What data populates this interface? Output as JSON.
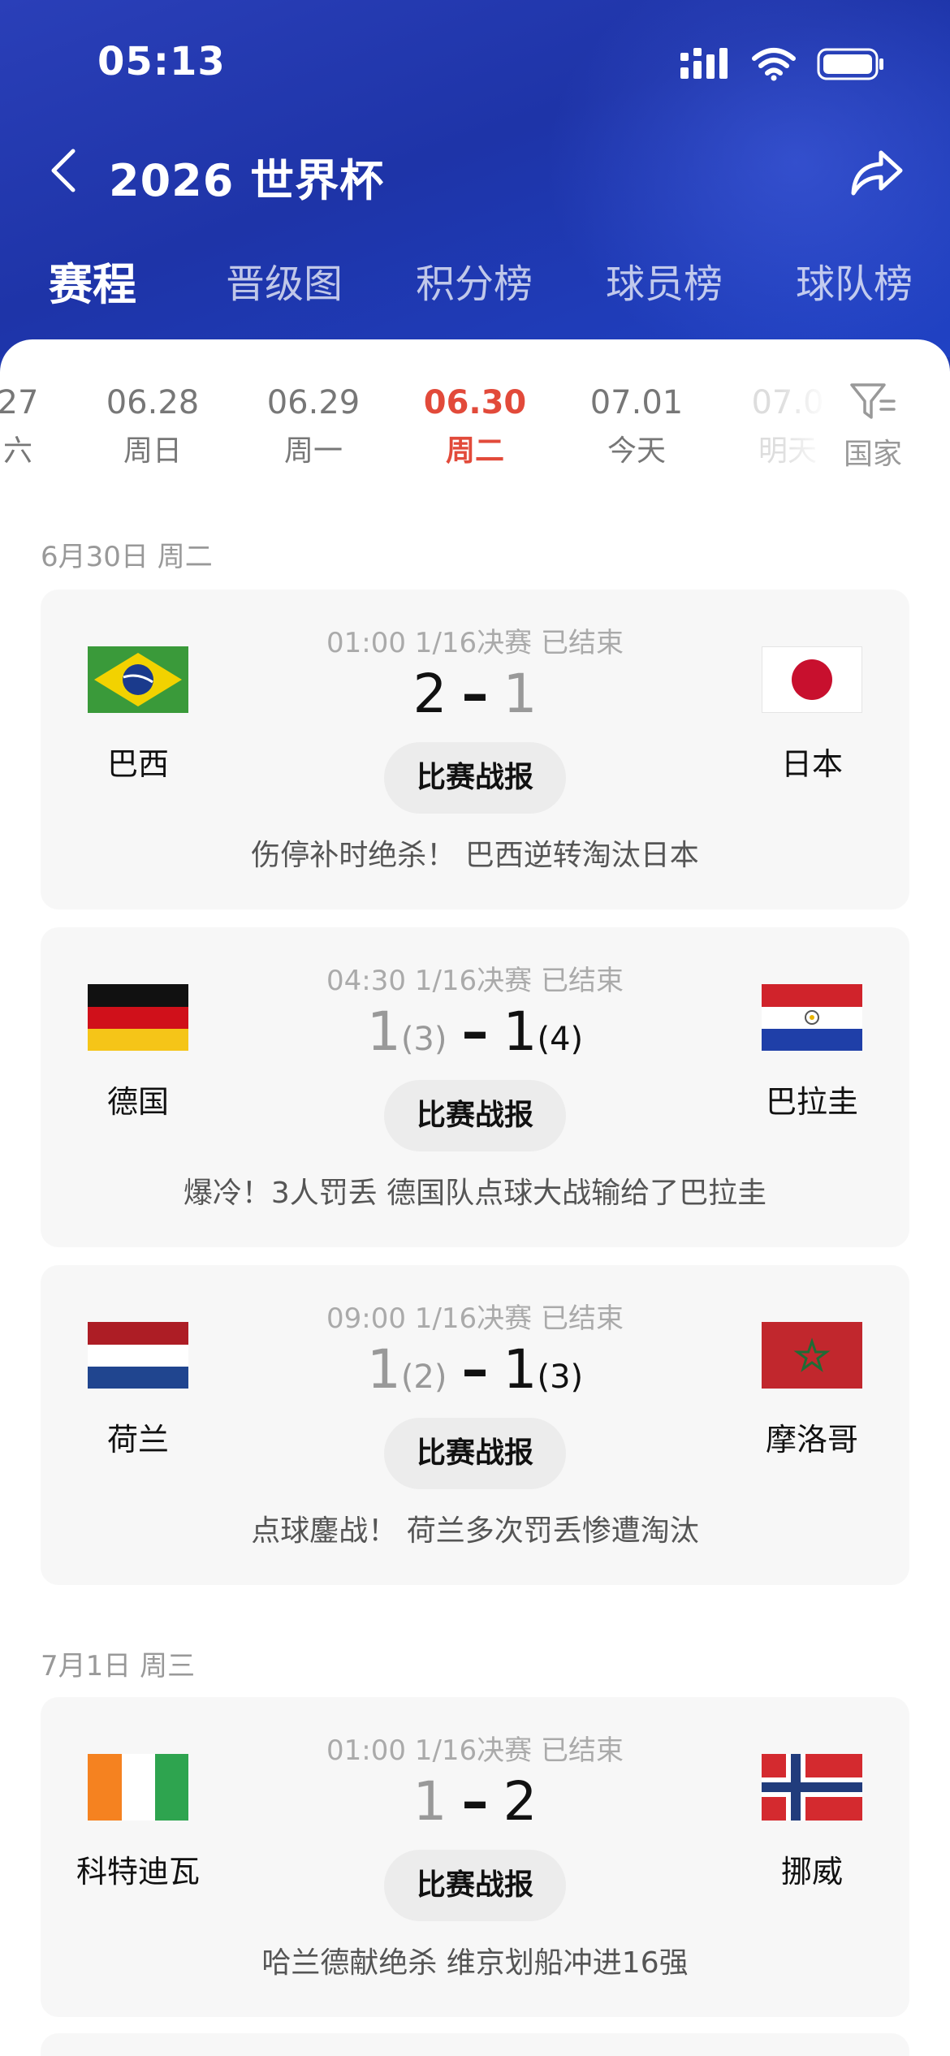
{
  "status": {
    "time": "05:13"
  },
  "nav": {
    "title": "2026 世界杯"
  },
  "tabs": [
    "赛程",
    "晋级图",
    "积分榜",
    "球员榜",
    "球队榜"
  ],
  "dates": [
    {
      "date": "27",
      "weekday": "六"
    },
    {
      "date": "06.28",
      "weekday": "周日"
    },
    {
      "date": "06.29",
      "weekday": "周一"
    },
    {
      "date": "06.30",
      "weekday": "周二"
    },
    {
      "date": "07.01",
      "weekday": "今天"
    },
    {
      "date": "07.0",
      "weekday": "明天"
    }
  ],
  "filter": {
    "label": "国家"
  },
  "sections": [
    {
      "date_label": "6月30日 周二",
      "matches": [
        {
          "info": "01:00 1/16决赛 已结束",
          "home": "巴西",
          "away": "日本",
          "home_score": "2",
          "away_score": "1",
          "home_pen": "",
          "away_pen": "",
          "report": "比赛战报",
          "headline": "伤停补时绝杀！ 巴西逆转淘汰日本"
        },
        {
          "info": "04:30 1/16决赛 已结束",
          "home": "德国",
          "away": "巴拉圭",
          "home_score": "1",
          "away_score": "1",
          "home_pen": "(3)",
          "away_pen": "(4)",
          "report": "比赛战报",
          "headline": "爆冷！3人罚丢 德国队点球大战输给了巴拉圭"
        },
        {
          "info": "09:00 1/16决赛 已结束",
          "home": "荷兰",
          "away": "摩洛哥",
          "home_score": "1",
          "away_score": "1",
          "home_pen": "(2)",
          "away_pen": "(3)",
          "report": "比赛战报",
          "headline": "点球鏖战！ 荷兰多次罚丢惨遭淘汰"
        }
      ]
    },
    {
      "date_label": "7月1日 周三",
      "matches": [
        {
          "info": "01:00 1/16决赛 已结束",
          "home": "科特迪瓦",
          "away": "挪威",
          "home_score": "1",
          "away_score": "2",
          "home_pen": "",
          "away_pen": "",
          "report": "比赛战报",
          "headline": "哈兰德献绝杀 维京划船冲进16强"
        }
      ]
    }
  ],
  "colors": {
    "header_blue": "#1f3ab0",
    "active_red": "#e24a3a"
  }
}
